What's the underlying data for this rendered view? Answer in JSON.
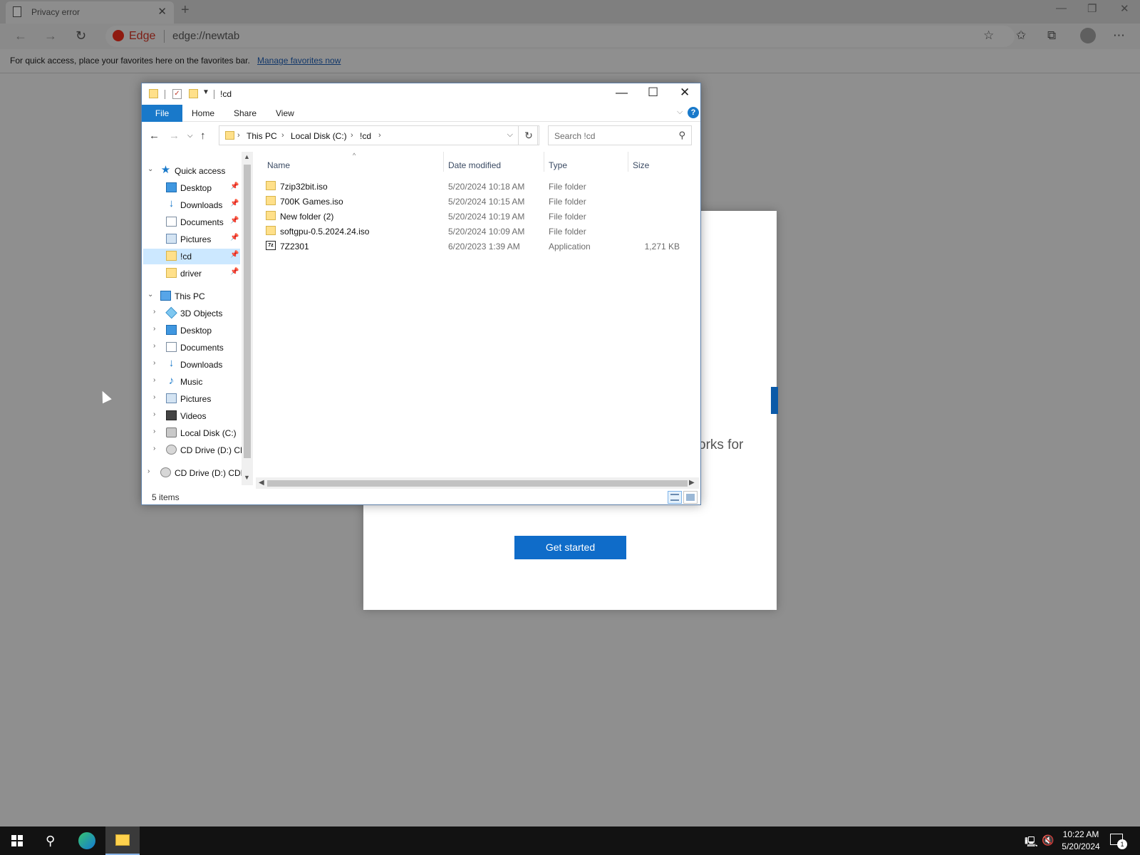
{
  "browser": {
    "tab_title": "Privacy error",
    "brand_label": "Edge",
    "url": "edge://newtab",
    "favorites_bar_text": "For quick access, place your favorites here on the favorites bar.",
    "favorites_bar_link": "Manage favorites now"
  },
  "welcome": {
    "partial_text": "orks for",
    "button_label": "Get started"
  },
  "explorer": {
    "title": "!cd",
    "ribbon_tabs": [
      "File",
      "Home",
      "Share",
      "View"
    ],
    "breadcrumb": [
      "This PC",
      "Local Disk (C:)",
      "!cd"
    ],
    "search_placeholder": "Search !cd",
    "columns": [
      "Name",
      "Date modified",
      "Type",
      "Size"
    ],
    "files": [
      {
        "name": "7zip32bit.iso",
        "date": "5/20/2024 10:18 AM",
        "type": "File folder",
        "size": "",
        "icon": "folder-icon"
      },
      {
        "name": "700K Games.iso",
        "date": "5/20/2024 10:15 AM",
        "type": "File folder",
        "size": "",
        "icon": "folder-icon"
      },
      {
        "name": "New folder (2)",
        "date": "5/20/2024 10:19 AM",
        "type": "File folder",
        "size": "",
        "icon": "folder-icon"
      },
      {
        "name": "softgpu-0.5.2024.24.iso",
        "date": "5/20/2024 10:09 AM",
        "type": "File folder",
        "size": "",
        "icon": "folder-icon"
      },
      {
        "name": "7Z2301",
        "date": "6/20/2023 1:39 AM",
        "type": "Application",
        "size": "1,271 KB",
        "icon": "7zip-app-icon"
      }
    ],
    "app_icon_text": "7z",
    "nav_pane": {
      "quick_access": "Quick access",
      "quick_items": [
        "Desktop",
        "Downloads",
        "Documents",
        "Pictures",
        "!cd",
        "driver"
      ],
      "this_pc": "This PC",
      "pc_items": [
        "3D Objects",
        "Desktop",
        "Documents",
        "Downloads",
        "Music",
        "Pictures",
        "Videos",
        "Local Disk (C:)",
        "CD Drive (D:) CD"
      ],
      "cd_drive": "CD Drive (D:) CDR"
    },
    "status": "5 items"
  },
  "taskbar": {
    "time": "10:22 AM",
    "date": "5/20/2024",
    "notification_count": "1"
  }
}
